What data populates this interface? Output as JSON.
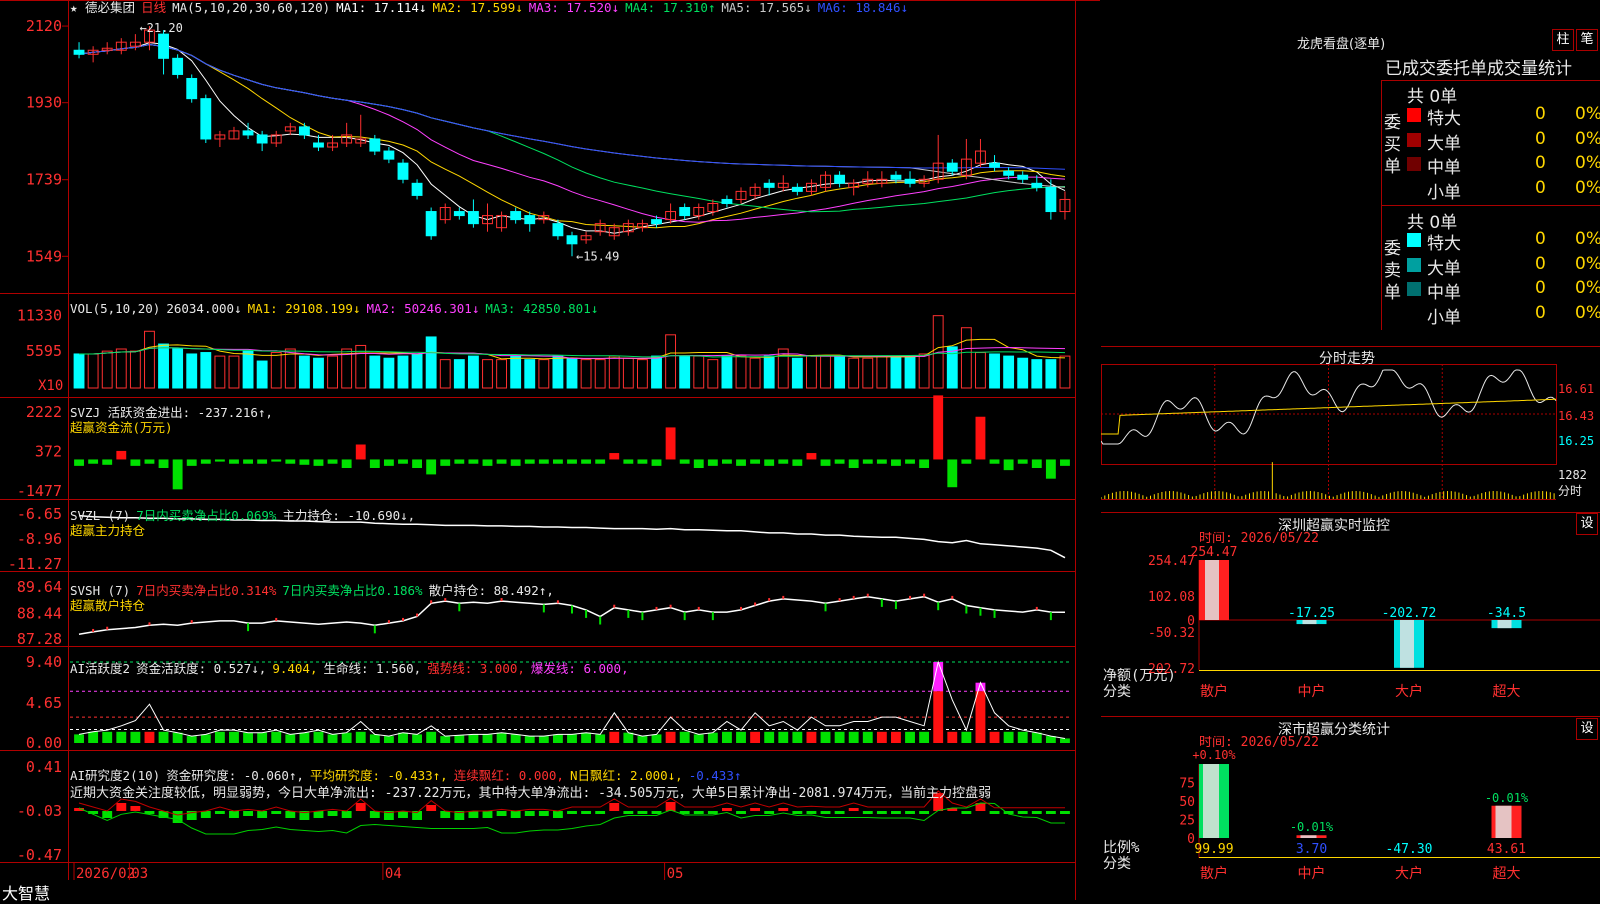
{
  "chart": {
    "title": "★ 德必集团",
    "period": "日线",
    "ma_params": "MA(5,10,20,30,60,120)",
    "ma_values": [
      {
        "label": "MA1:",
        "value": "17.114↓",
        "color": "#ffffff"
      },
      {
        "label": "MA2:",
        "value": "17.599↓",
        "color": "#ffd700"
      },
      {
        "label": "MA3:",
        "value": "17.520↓",
        "color": "#ff40ff"
      },
      {
        "label": "MA4:",
        "value": "17.310↑",
        "color": "#00e060"
      },
      {
        "label": "MA5:",
        "value": "17.565↓",
        "color": "#c8c8c8"
      },
      {
        "label": "MA6:",
        "value": "18.846↓",
        "color": "#3050ff"
      }
    ],
    "high_mark": "21.20",
    "low_mark": "15.49",
    "price_axis": [
      "2120",
      "1930",
      "1739",
      "1549"
    ],
    "vol_header": {
      "params": "VOL(5,10,20)",
      "value": "26034.000↓",
      "ma1": "MA1: 29108.199↓",
      "ma2": "MA2: 50246.301↓",
      "ma3": "MA3: 42850.801↓"
    },
    "vol_axis": [
      "11330",
      "5595"
    ],
    "vol_unit": "X10",
    "svzj": {
      "line1": "SVZJ  活跃资金进出: -237.216↑,",
      "line2": "超赢资金流(万元)",
      "axis": [
        "2222",
        "372",
        "-1477"
      ]
    },
    "svzl": {
      "line1_a": "SVZL (7)",
      "line1_b": "7日内买卖净占比0.069%",
      "line1_c": "主力持仓: -10.690↓,",
      "line2": "超赢主力持仓",
      "axis": [
        "-6.65",
        "-8.96",
        "-11.27"
      ]
    },
    "svsh": {
      "line1_a": "SVSH (7)",
      "line1_b": "7日内买卖净占比0.314%",
      "line1_c": "7日内买卖净占比0.186%",
      "line1_d": "散户持仓: 88.492↑,",
      "line2": "超赢散户持仓",
      "axis": [
        "89.64",
        "88.44",
        "87.28"
      ]
    },
    "ai1": {
      "a": "AI活跃度2",
      "b": "资金活跃度: 0.527↓,",
      "c": "9.404,",
      "d": "生命线: 1.560,",
      "e": "强势线: 3.000,",
      "f": "爆发线: 6.000,",
      "axis": [
        "9.40",
        "4.65",
        "0.00"
      ]
    },
    "ai2": {
      "a": "AI研究度2(10)",
      "b": "资金研究度: -0.060↑,",
      "c": "平均研究度: -0.433↑,",
      "d": "连续飘红: 0.000,",
      "e": "N日飘红: 2.000↓,",
      "f": "-0.433↑",
      "comment": "近期大资金关注度较低，明显弱势，今日大单净流出: -237.22万元，其中特大单净流出: -34.505万元，大单5日累计净出-2081.974万元，当前主力控盘弱",
      "axis": [
        "0.41",
        "-0.03",
        "-0.47"
      ]
    },
    "dates": [
      "2026/02",
      "03",
      "04",
      "05"
    ],
    "logo": "大智慧"
  },
  "chart_data": {
    "type": "candlestick",
    "title": "德必集团 日线",
    "ohlc": [
      [
        20.6,
        20.8,
        20.4,
        20.5
      ],
      [
        20.5,
        20.7,
        20.3,
        20.6
      ],
      [
        20.6,
        20.8,
        20.5,
        20.65
      ],
      [
        20.6,
        20.9,
        20.5,
        20.8
      ],
      [
        20.7,
        21.0,
        20.6,
        20.8
      ],
      [
        20.8,
        21.2,
        20.6,
        21.1
      ],
      [
        21.0,
        21.1,
        20.0,
        20.4
      ],
      [
        20.4,
        20.5,
        19.9,
        20.0
      ],
      [
        19.9,
        20.0,
        19.3,
        19.4
      ],
      [
        19.4,
        19.5,
        18.3,
        18.4
      ],
      [
        18.4,
        18.6,
        18.2,
        18.5
      ],
      [
        18.4,
        18.7,
        18.4,
        18.6
      ],
      [
        18.6,
        18.8,
        18.4,
        18.5
      ],
      [
        18.5,
        18.6,
        18.1,
        18.3
      ],
      [
        18.3,
        18.6,
        18.2,
        18.5
      ],
      [
        18.6,
        18.8,
        18.5,
        18.7
      ],
      [
        18.7,
        18.8,
        18.4,
        18.5
      ],
      [
        18.3,
        18.5,
        18.1,
        18.2
      ],
      [
        18.2,
        18.5,
        18.1,
        18.3
      ],
      [
        18.3,
        18.8,
        18.2,
        18.5
      ],
      [
        18.3,
        19.0,
        18.2,
        18.4
      ],
      [
        18.4,
        18.5,
        18.0,
        18.1
      ],
      [
        18.1,
        18.2,
        17.8,
        17.9
      ],
      [
        17.8,
        17.9,
        17.3,
        17.4
      ],
      [
        17.3,
        17.4,
        16.9,
        17.0
      ],
      [
        16.6,
        16.7,
        15.9,
        16.0
      ],
      [
        16.4,
        16.8,
        16.3,
        16.7
      ],
      [
        16.6,
        16.7,
        16.4,
        16.5
      ],
      [
        16.6,
        16.9,
        16.2,
        16.3
      ],
      [
        16.3,
        16.8,
        16.1,
        16.5
      ],
      [
        16.2,
        16.6,
        16.1,
        16.5
      ],
      [
        16.6,
        16.7,
        16.3,
        16.4
      ],
      [
        16.5,
        16.6,
        16.1,
        16.3
      ],
      [
        16.4,
        16.6,
        16.3,
        16.5
      ],
      [
        16.3,
        16.4,
        15.9,
        16.0
      ],
      [
        16.0,
        16.1,
        15.49,
        15.8
      ],
      [
        15.9,
        16.1,
        15.8,
        16.0
      ],
      [
        16.1,
        16.4,
        16.0,
        16.3
      ],
      [
        16.0,
        16.3,
        15.9,
        16.2
      ],
      [
        16.1,
        16.4,
        16.0,
        16.3
      ],
      [
        16.2,
        16.4,
        16.1,
        16.3
      ],
      [
        16.4,
        16.5,
        16.2,
        16.3
      ],
      [
        16.4,
        16.8,
        16.3,
        16.6
      ],
      [
        16.7,
        16.8,
        16.4,
        16.5
      ],
      [
        16.5,
        16.8,
        16.4,
        16.7
      ],
      [
        16.6,
        16.9,
        16.5,
        16.8
      ],
      [
        16.9,
        17.0,
        16.7,
        16.8
      ],
      [
        16.9,
        17.2,
        16.8,
        17.1
      ],
      [
        17.0,
        17.3,
        16.9,
        17.2
      ],
      [
        17.3,
        17.4,
        17.0,
        17.2
      ],
      [
        17.2,
        17.5,
        17.1,
        17.3
      ],
      [
        17.2,
        17.3,
        17.0,
        17.1
      ],
      [
        17.1,
        17.4,
        17.0,
        17.3
      ],
      [
        17.2,
        17.6,
        17.1,
        17.5
      ],
      [
        17.5,
        17.6,
        17.2,
        17.3
      ],
      [
        17.2,
        17.4,
        17.0,
        17.3
      ],
      [
        17.3,
        17.6,
        17.2,
        17.4
      ],
      [
        17.3,
        17.6,
        17.2,
        17.4
      ],
      [
        17.5,
        17.6,
        17.3,
        17.4
      ],
      [
        17.4,
        17.6,
        17.2,
        17.3
      ],
      [
        17.3,
        17.5,
        17.2,
        17.4
      ],
      [
        17.4,
        18.5,
        17.3,
        17.8
      ],
      [
        17.8,
        17.9,
        17.5,
        17.6
      ],
      [
        17.5,
        18.4,
        17.4,
        17.9
      ],
      [
        17.8,
        18.4,
        17.7,
        18.1
      ],
      [
        17.8,
        18.0,
        17.6,
        17.7
      ],
      [
        17.6,
        17.7,
        17.4,
        17.5
      ],
      [
        17.5,
        17.6,
        17.3,
        17.4
      ],
      [
        17.3,
        17.5,
        17.1,
        17.2
      ],
      [
        17.2,
        17.4,
        16.4,
        16.6
      ],
      [
        16.6,
        17.1,
        16.4,
        16.9
      ]
    ],
    "volume": [
      48,
      48,
      52,
      55,
      52,
      80,
      62,
      55,
      48,
      50,
      45,
      45,
      52,
      38,
      50,
      55,
      45,
      42,
      45,
      55,
      60,
      45,
      42,
      45,
      48,
      72,
      40,
      40,
      45,
      40,
      40,
      45,
      40,
      40,
      45,
      42,
      40,
      40,
      45,
      42,
      40,
      45,
      75,
      45,
      45,
      40,
      45,
      45,
      42,
      45,
      55,
      42,
      45,
      45,
      45,
      42,
      42,
      45,
      45,
      45,
      48,
      102,
      58,
      85,
      50,
      48,
      45,
      42,
      40,
      40,
      45
    ],
    "svzj": [
      -300,
      -200,
      -250,
      400,
      -300,
      -200,
      -400,
      -1400,
      -300,
      -200,
      -100,
      -200,
      -200,
      -200,
      -100,
      -200,
      -250,
      -300,
      -200,
      -400,
      700,
      -400,
      -300,
      -200,
      -400,
      -700,
      -300,
      -200,
      -200,
      -300,
      -200,
      -300,
      -200,
      -200,
      -200,
      -200,
      -200,
      -200,
      300,
      -200,
      -200,
      -300,
      1500,
      -200,
      -400,
      -300,
      -200,
      -300,
      -200,
      -300,
      -200,
      -300,
      300,
      -300,
      -200,
      -400,
      -200,
      -200,
      -300,
      -200,
      -400,
      3000,
      -1300,
      -200,
      2000,
      -200,
      -500,
      -200,
      -400,
      -900,
      -300
    ],
    "svzl": [
      -6.8,
      -6.9,
      -6.95,
      -7.0,
      -7.0,
      -7.05,
      -7.05,
      -7.1,
      -7.1,
      -7.15,
      -7.15,
      -7.2,
      -7.2,
      -7.25,
      -7.25,
      -7.3,
      -7.3,
      -7.35,
      -7.4,
      -7.4,
      -7.4,
      -7.5,
      -7.55,
      -7.6,
      -7.6,
      -7.65,
      -7.7,
      -7.7,
      -7.7,
      -7.75,
      -7.75,
      -7.8,
      -7.8,
      -7.85,
      -7.85,
      -7.9,
      -7.9,
      -7.95,
      -8.0,
      -8.0,
      -8.0,
      -8.05,
      -8.0,
      -8.1,
      -8.1,
      -8.15,
      -8.2,
      -8.2,
      -8.3,
      -8.4,
      -8.4,
      -8.5,
      -8.5,
      -8.6,
      -8.6,
      -8.7,
      -8.75,
      -8.8,
      -8.8,
      -8.9,
      -9.0,
      -9.2,
      -9.3,
      -9.1,
      -9.4,
      -9.5,
      -9.6,
      -9.7,
      -9.8,
      -10.0,
      -10.69
    ],
    "svsh": [
      87.5,
      87.6,
      87.7,
      87.75,
      87.8,
      87.9,
      87.95,
      87.9,
      88.0,
      88.05,
      88.1,
      88.1,
      88.0,
      88.0,
      88.1,
      88.05,
      88.0,
      87.95,
      88.0,
      88.05,
      88.0,
      87.9,
      88.0,
      88.1,
      88.3,
      88.9,
      89.0,
      88.9,
      88.95,
      88.9,
      89.0,
      88.95,
      88.9,
      88.85,
      88.9,
      88.8,
      88.6,
      88.3,
      88.7,
      88.6,
      88.5,
      88.6,
      88.7,
      88.5,
      88.6,
      88.5,
      88.5,
      88.6,
      88.8,
      89.0,
      89.1,
      89.05,
      89.0,
      88.9,
      89.0,
      89.1,
      89.2,
      89.1,
      89.0,
      89.1,
      89.2,
      88.95,
      89.1,
      88.8,
      88.7,
      88.6,
      88.55,
      88.5,
      88.6,
      88.5,
      88.49
    ],
    "ai1": [
      1.0,
      1.3,
      1.5,
      2.0,
      2.6,
      4.5,
      1.5,
      1.2,
      0.8,
      1.0,
      1.5,
      1.5,
      1.2,
      1.2,
      1.5,
      1.0,
      1.2,
      1.5,
      1.0,
      1.2,
      2.5,
      1.0,
      0.8,
      1.2,
      1.0,
      2.0,
      0.8,
      0.9,
      1.0,
      1.0,
      1.2,
      1.0,
      0.8,
      0.8,
      1.0,
      1.0,
      1.2,
      1.0,
      3.5,
      1.2,
      0.8,
      1.0,
      3.0,
      1.5,
      1.0,
      1.2,
      2.5,
      1.5,
      3.5,
      2.0,
      2.5,
      1.5,
      3.0,
      2.0,
      2.0,
      2.5,
      2.5,
      3.0,
      3.0,
      2.5,
      2.0,
      9.4,
      5.0,
      1.5,
      7.0,
      3.5,
      2.0,
      1.5,
      1.2,
      0.8,
      0.527
    ],
    "ai2": [
      0.0,
      -0.05,
      -0.1,
      0.05,
      0.02,
      -0.05,
      -0.1,
      -0.15,
      -0.12,
      -0.1,
      -0.05,
      -0.1,
      -0.08,
      -0.1,
      -0.05,
      -0.1,
      -0.12,
      -0.1,
      -0.08,
      -0.1,
      0.05,
      -0.1,
      -0.12,
      -0.1,
      -0.12,
      0.03,
      -0.1,
      -0.12,
      -0.1,
      -0.1,
      -0.08,
      -0.1,
      -0.08,
      -0.08,
      -0.1,
      -0.05,
      -0.05,
      -0.05,
      0.05,
      -0.05,
      -0.05,
      -0.05,
      0.06,
      -0.05,
      -0.05,
      -0.05,
      0.0,
      -0.05,
      0.0,
      -0.05,
      0.0,
      -0.05,
      -0.04,
      -0.05,
      -0.05,
      0.0,
      -0.05,
      -0.05,
      -0.05,
      -0.05,
      -0.05,
      0.15,
      0.0,
      -0.05,
      0.05,
      -0.06,
      -0.06,
      -0.06,
      -0.06,
      -0.06,
      -0.06
    ],
    "price_range": [
      15.2,
      21.4
    ]
  },
  "side": {
    "lhb_title": "龙虎看盘(逐单)",
    "btn_zhu": "柱",
    "btn_bi": "笔",
    "table_title": "已成交委托单成交量统计",
    "buy_label": "委买单",
    "sell_label": "委卖单",
    "buy_total": "共 0单",
    "sell_total": "共 0单",
    "buy_rows": [
      {
        "name": "特大",
        "vol": "0",
        "pct": "0%",
        "color": "#ff0000"
      },
      {
        "name": "大单",
        "vol": "0",
        "pct": "0%",
        "color": "#a00000"
      },
      {
        "name": "中单",
        "vol": "0",
        "pct": "0%",
        "color": "#700000"
      },
      {
        "name": "小单",
        "vol": "0",
        "pct": "0%",
        "color": "#000000"
      }
    ],
    "sell_rows": [
      {
        "name": "特大",
        "vol": "0",
        "pct": "0%",
        "color": "#00ffff"
      },
      {
        "name": "大单",
        "vol": "0",
        "pct": "0%",
        "color": "#00a0a0"
      },
      {
        "name": "中单",
        "vol": "0",
        "pct": "0%",
        "color": "#007070"
      },
      {
        "name": "小单",
        "vol": "0",
        "pct": "0%",
        "color": "#000000"
      }
    ],
    "intraday_title": "分时走势",
    "intraday_axis": [
      "16.61",
      "16.43",
      "16.25"
    ],
    "intraday_vol": "1282",
    "intraday_vol_unit": "分时",
    "monitor_title": "深圳超赢实时监控",
    "monitor_btn": "设",
    "monitor_date": "时间: 2026/05/22",
    "monitor_axis": [
      "254.47",
      "102.08",
      "0",
      "-50.32",
      "-202.72"
    ],
    "monitor_values": [
      {
        "label": "散户",
        "val": "254.47",
        "num": 254.47
      },
      {
        "label": "中户",
        "val": "-17.25",
        "num": -17.25
      },
      {
        "label": "大户",
        "val": "-202.72",
        "num": -202.72
      },
      {
        "label": "超大",
        "val": "-34.5",
        "num": -34.5
      }
    ],
    "monitor_unit1": "净额(万元)",
    "monitor_unit2": "分类",
    "class_title": "深市超赢分类统计",
    "class_btn": "设",
    "class_date": "时间: 2026/05/22",
    "class_axis": [
      "75",
      "50",
      "25",
      "0"
    ],
    "class_top": [
      {
        "val": "+0.10%"
      },
      {
        "val": "-0.01%"
      },
      {
        "val": ""
      },
      {
        "val": "-0.01%"
      }
    ],
    "class_bottom": [
      {
        "label": "散户",
        "val": "99.99",
        "num": 99.99
      },
      {
        "label": "中户",
        "val": "3.70",
        "num": 3.7
      },
      {
        "label": "大户",
        "val": "-47.30",
        "num": -47.3
      },
      {
        "label": "超大",
        "val": "43.61",
        "num": 43.61
      }
    ],
    "class_unit1": "比例%",
    "class_unit2": "分类"
  }
}
